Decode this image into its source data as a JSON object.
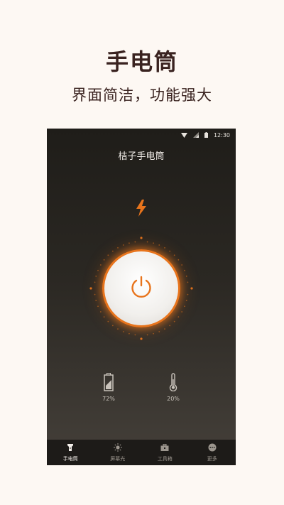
{
  "promo": {
    "title": "手电筒",
    "subtitle": "界面简洁，功能强大"
  },
  "status_bar": {
    "time": "12:30",
    "icons": [
      "wifi-icon",
      "signal-icon",
      "battery-icon"
    ]
  },
  "app": {
    "title": "桔子手电筒",
    "flash_icon": "lightning-bolt-icon",
    "power_icon": "power-icon"
  },
  "stats": {
    "battery": {
      "icon": "battery-icon",
      "value": "72%"
    },
    "temperature": {
      "icon": "thermometer-icon",
      "value": "20%"
    }
  },
  "tabs": [
    {
      "label": "手电筒",
      "icon": "flashlight-icon",
      "active": true
    },
    {
      "label": "屏幕光",
      "icon": "sun-icon",
      "active": false
    },
    {
      "label": "工具箱",
      "icon": "toolbox-icon",
      "active": false
    },
    {
      "label": "更多",
      "icon": "more-icon",
      "active": false
    }
  ],
  "colors": {
    "accent": "#e8741c",
    "promo_background": "#fdf8f3",
    "promo_text": "#3a2320",
    "phone_background_top": "#1f1d19",
    "phone_background_bottom": "#45403a"
  }
}
